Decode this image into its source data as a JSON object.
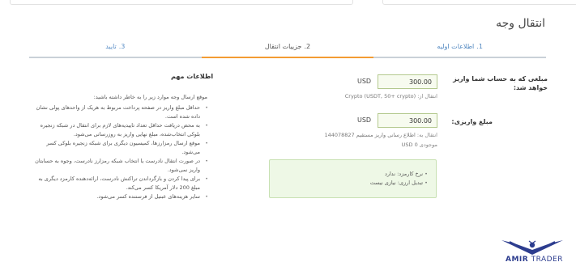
{
  "page": {
    "title": "انتقال وجه"
  },
  "steps": [
    {
      "num": "1.",
      "label": "اطلاعات اولیه"
    },
    {
      "num": "2.",
      "label": "جزییات انتقال"
    },
    {
      "num": "3.",
      "label": "تایید"
    }
  ],
  "deposit": {
    "label": "مبلغی که به حساب شما واریز خواهد شد:",
    "value": "300.00",
    "currency": "USD",
    "hint_prefix": "انتقال از:",
    "hint_value": "Crypto (USDT, 50+ crypto)"
  },
  "payment": {
    "label": "مبلغ واریزی:",
    "value": "300.00",
    "currency": "USD",
    "hint_prefix": "انتقال به:",
    "hint_value": "اطلاع رسانی واریز مستقیم 144078827",
    "balance_prefix": "موجودی",
    "balance_value": "USD 0"
  },
  "fees": {
    "line1": "نرخ کارمزد: ندارد",
    "line2": "تبدیل ارزی: نیازی نیست"
  },
  "important": {
    "title": "اطلاعات مهم",
    "intro": "موقع ارسال وجه موارد زیر را به خاطر داشته باشید:",
    "items": [
      "حداقل مبلغ واریز در صفحه پرداخت مربوط به هریک از واحدهای پولی نشان داده شده است.",
      "به محض دریافت حداقل تعداد تاییدیه‌های لازم برای انتقال در شبکه زنجیره بلوکی انتخاب‌شده، مبلغ نهایی واریز به روزرسانی می‌شود.",
      "موقع ارسال رمزارزها، کمیسیون دیگری برای شبکه زنجیره بلوکی کسر می‌شود.",
      "در صورت انتقال نادرست یا انتخاب شبکه رمزارز نادرست، وجوه به حسابتان واریز نمی‌شود.",
      "برای پیدا کردن و بازگرداندن تراکنش نادرست، ارائه‌دهنده کارمزد دیگری به مبلغ 200 دلار آمریکا کسر می‌کند.",
      "سایر هزینه‌های عبنیل از فرستنده کسر می‌شود."
    ]
  },
  "logo": {
    "word1": "AMIR",
    "word2": "TRADER"
  },
  "colors": {
    "active_step": "#f39c33",
    "link": "#4f86c0",
    "input_border": "#b4c98e",
    "info_box": "#eef8e6",
    "brand": "#2d3d8f"
  }
}
